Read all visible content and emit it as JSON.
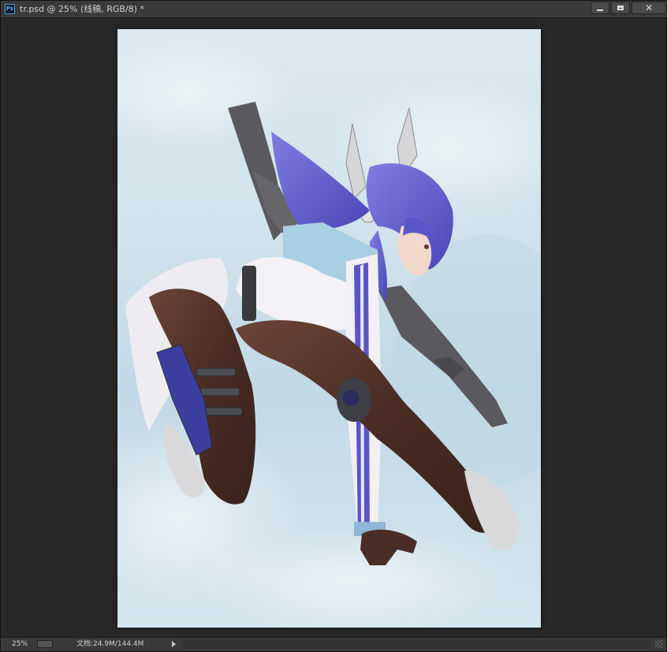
{
  "window": {
    "app_icon": "Ps",
    "title": "tr.psd @ 25% (线稿, RGB/8) *",
    "buttons": {
      "minimize_icon": "minimize-icon",
      "maximize_icon": "maximize-icon",
      "close_icon": "close-icon",
      "close_glyph": "✕"
    }
  },
  "canvas": {
    "background_color": "#cfe2eb",
    "content": "digital painting"
  },
  "statusbar": {
    "zoom": "25%",
    "doc_info": "文档:24.9M/144.4M"
  },
  "colors": {
    "chrome": "#3a3a3a",
    "workspace": "#282828",
    "accent_ps": "#3fa0e0"
  }
}
